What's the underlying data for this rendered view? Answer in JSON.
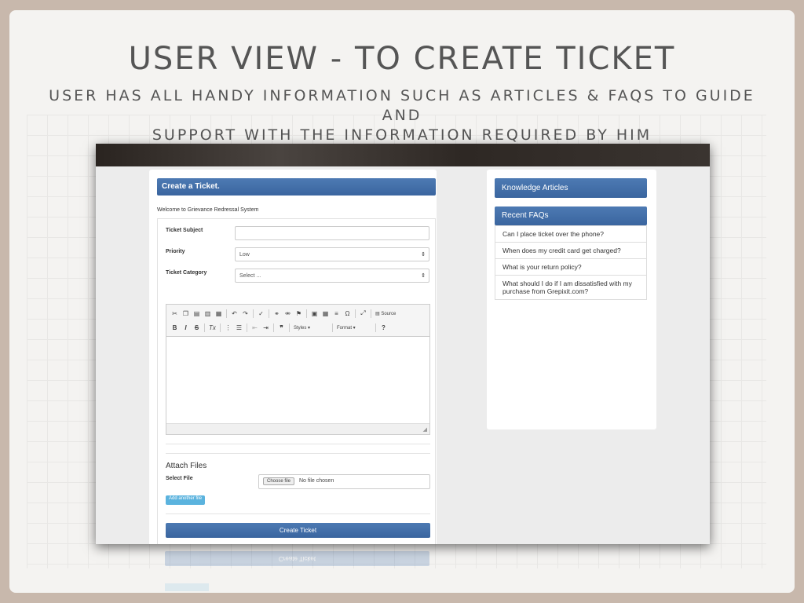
{
  "slide": {
    "title": "USER VIEW - TO CREATE TICKET",
    "subtitle_line1": "USER HAS ALL HANDY INFORMATION SUCH AS ARTICLES & FAQS TO GUIDE AND",
    "subtitle_line2": "SUPPORT WITH THE INFORMATION REQUIRED BY HIM"
  },
  "form": {
    "header": "Create a Ticket.",
    "welcome": "Welcome to Grievance Redressal System",
    "subject_label": "Ticket Subject",
    "subject_value": "",
    "priority_label": "Priority",
    "priority_value": "Low",
    "category_label": "Ticket Category",
    "category_value": "Select ...",
    "editor": {
      "source_label": "Source",
      "styles_label": "Styles",
      "format_label": "Format"
    },
    "attach_title": "Attach Files",
    "select_file_label": "Select File",
    "choose_file_label": "Choose file",
    "no_file_text": "No file chosen",
    "add_file_label": "Add another file",
    "create_button": "Create Ticket"
  },
  "sidebar": {
    "knowledge_articles": "Knowledge Articles",
    "recent_faqs": "Recent FAQs",
    "faqs": [
      "Can I place ticket over the phone?",
      "When does my credit card get charged?",
      "What is your return policy?",
      "What should I do if I am dissatisfied with my purchase from Grepixit.com?"
    ]
  },
  "colors": {
    "accent": "#3a659f",
    "info_button": "#5bb3de",
    "title_text": "#555555"
  }
}
